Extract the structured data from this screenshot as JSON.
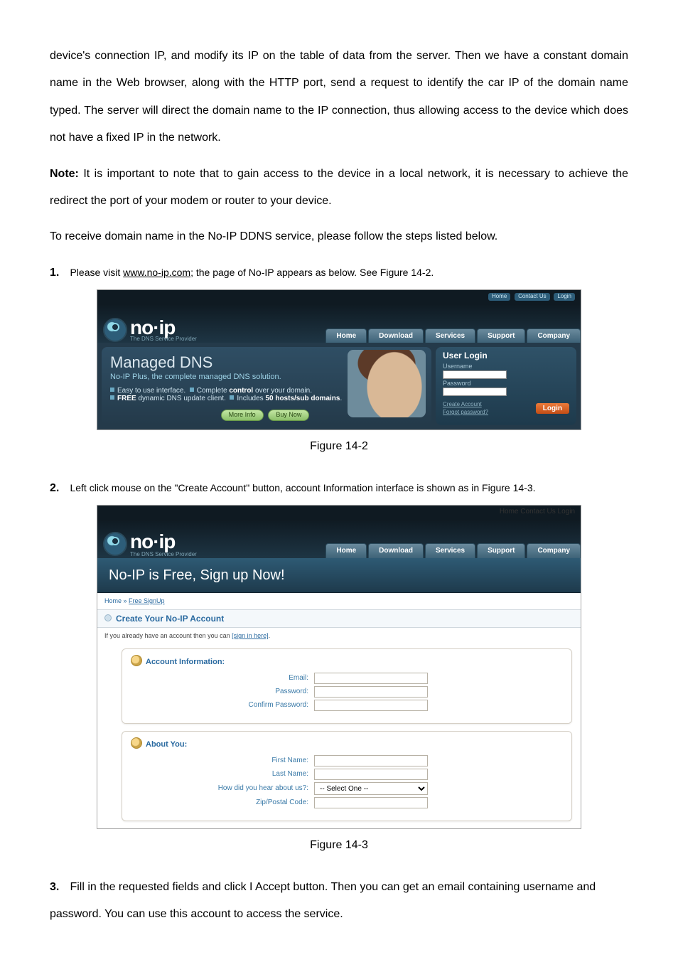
{
  "paragraphs": {
    "p1": "device's connection IP, and modify its IP on the table of data from the server. Then we have a constant domain name in the Web browser, along with the HTTP port, send a request to identify the car IP of the domain name typed. The server will direct the domain name to the IP connection, thus allowing access to the device which does not have a fixed IP in the network.",
    "note_label": "Note:",
    "note_body": " It is important to note that to gain access to the device in a local network, it is necessary to achieve the redirect the port of your modem or router to your device.",
    "p3": "To receive domain name in the No-IP DDNS service, please follow the steps listed below."
  },
  "steps": {
    "s1_num": "1.",
    "s1_a": "Please visit ",
    "s1_link": "www.no-ip.com",
    "s1_b": "; the page of No-IP appears as below. See Figure 14-2.",
    "s2_num": "2.",
    "s2_text": "Left click mouse on the \"Create Account\" button, account Information interface is shown as in Figure 14-3.",
    "s3_num": "3.",
    "s3_text": "Fill in the requested fields and click I Accept button.   Then you can get an email containing username and password. You can use this account to access the service."
  },
  "captions": {
    "fig142": "Figure 14-2",
    "fig143": "Figure 14-3"
  },
  "shot1": {
    "top_home": "Home",
    "top_contact": "Contact Us",
    "top_login": "Login",
    "logo_text": "no·ip",
    "logo_tag": "The DNS Service Provider",
    "nav": [
      "Home",
      "Download",
      "Services",
      "Support",
      "Company"
    ],
    "panel_title": "Managed DNS",
    "panel_sub": "No-IP Plus, the complete managed DNS solution.",
    "b1a": "Easy to use interface.",
    "b1b": "Complete ",
    "b1c": "control",
    "b1d": " over your domain.",
    "b2a": "FREE",
    "b2b": " dynamic DNS update client.",
    "b2c": "Includes ",
    "b2d": "50 hosts/sub domains",
    "b2e": ".",
    "more_info": "More Info",
    "buy_now": "Buy Now",
    "login_title": "User Login",
    "username_label": "Username",
    "password_label": "Password",
    "create_account": "Create Account",
    "forgot_password": "Forgot password?",
    "login_btn": "Login"
  },
  "shot2": {
    "banner": "No-IP is Free, Sign up Now!",
    "bc_home": "Home",
    "bc_sep": " »  ",
    "bc_signup": "Free SignUp",
    "section_title": "Create Your No-IP Account",
    "hint_a": "If you already have an account then you can ",
    "hint_link": "[sign in here]",
    "card1_title": "Account Information:",
    "email": "Email:",
    "password": "Password:",
    "confirm": "Confirm Password:",
    "card2_title": "About You:",
    "first": "First Name:",
    "last": "Last Name:",
    "hear": "How did you hear about us?:",
    "hear_opt": "-- Select One --",
    "zip": "Zip/Postal Code:"
  }
}
